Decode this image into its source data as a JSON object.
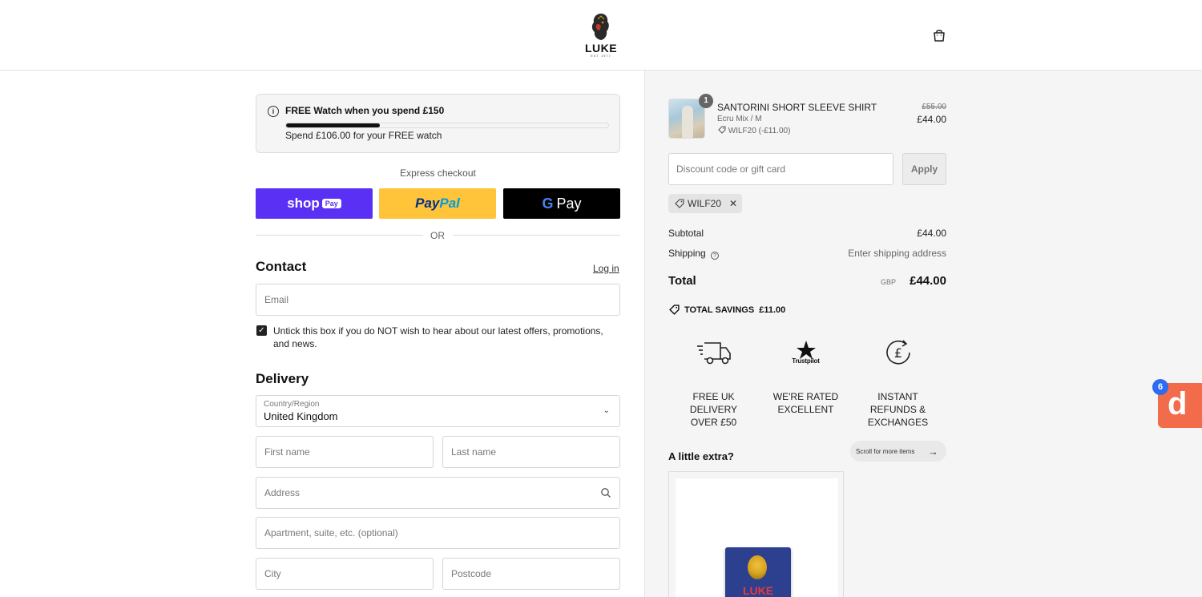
{
  "header": {
    "brand": "LUKE",
    "brand_sub": "EST 1977"
  },
  "promo": {
    "title": "FREE Watch when you spend £150",
    "progress": 0.29,
    "subtitle": "Spend £106.00 for your FREE watch"
  },
  "express": {
    "label": "Express checkout",
    "shop_pay": "shop",
    "shop_pay_tag": "Pay",
    "paypal_a": "Pay",
    "paypal_b": "Pal",
    "gpay_g": "G",
    "gpay_text": "Pay",
    "or": "OR"
  },
  "contact": {
    "title": "Contact",
    "login": "Log in",
    "email_placeholder": "Email",
    "marketing_label": "Untick this box if you do NOT wish to hear about our latest offers, promotions, and news."
  },
  "delivery": {
    "title": "Delivery",
    "country_label": "Country/Region",
    "country_value": "United Kingdom",
    "first_name": "First name",
    "last_name": "Last name",
    "address": "Address",
    "apartment": "Apartment, suite, etc. (optional)",
    "city": "City",
    "postcode": "Postcode"
  },
  "order": {
    "quantity": "1",
    "product_name": "SANTORINI SHORT SLEEVE SHIRT",
    "variant": "Ecru Mix / M",
    "discount_line": "WILF20 (-£11.00)",
    "old_price": "£55.00",
    "price": "£44.00",
    "discount_placeholder": "Discount code or gift card",
    "apply": "Apply",
    "code_chip": "WILF20",
    "subtotal_label": "Subtotal",
    "subtotal_value": "£44.00",
    "shipping_label": "Shipping",
    "shipping_value": "Enter shipping address",
    "total_label": "Total",
    "currency": "GBP",
    "total_value": "£44.00",
    "savings": "TOTAL SAVINGS",
    "savings_value": "£11.00"
  },
  "usps": [
    {
      "icon": "delivery-truck-icon",
      "text": "FREE UK DELIVERY OVER £50"
    },
    {
      "icon": "trustpilot-star-icon",
      "text": "WE'RE RATED EXCELLENT",
      "sub": "Trustpilot"
    },
    {
      "icon": "pound-refund-icon",
      "text": "INSTANT REFUNDS & EXCHANGES"
    }
  ],
  "extras": {
    "title": "A little extra?",
    "scroll": "Scroll for more items",
    "product_brand": "LUKE"
  },
  "widget": {
    "badge": "6",
    "letter": "d"
  },
  "colors": {
    "shop_pay": "#5a31f4",
    "paypal": "#ffc439",
    "gpay": "#000000",
    "widget": "#f26b4a"
  }
}
